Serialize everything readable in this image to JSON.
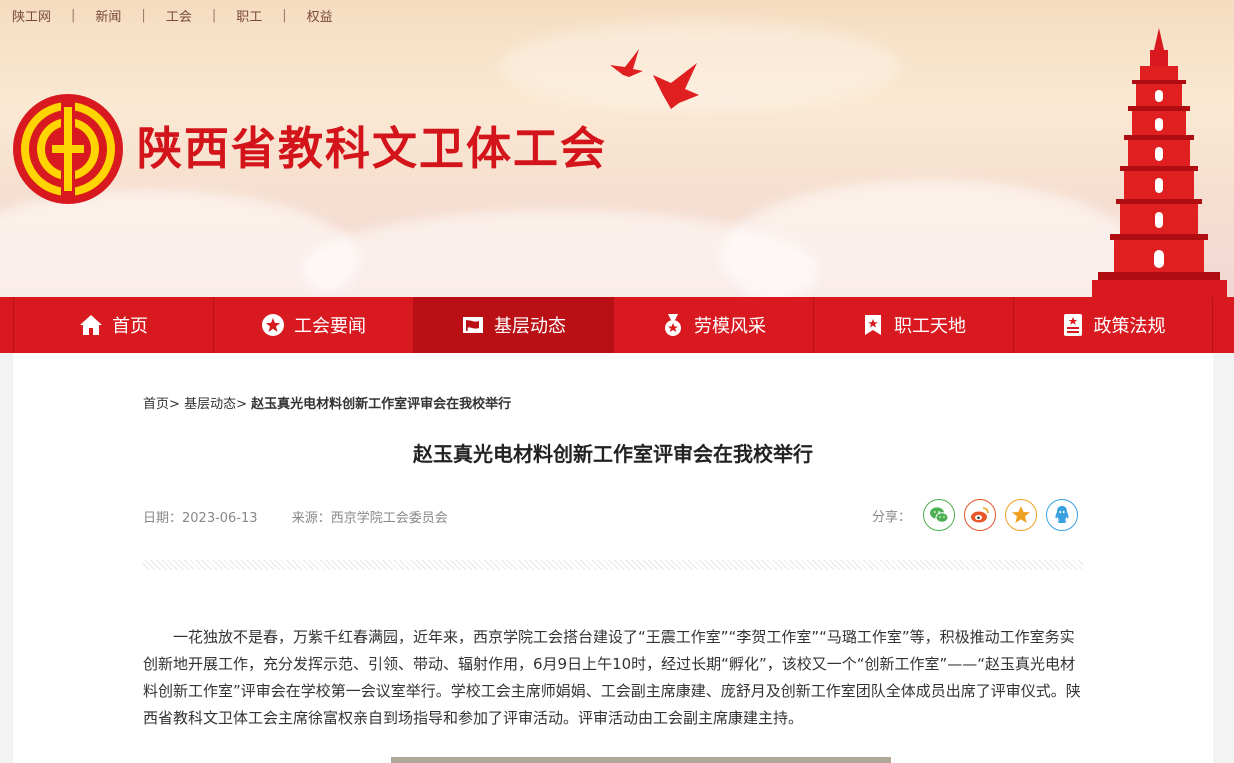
{
  "toplinks": [
    "陕工网",
    "新闻",
    "工会",
    "职工",
    "权益"
  ],
  "site_title": "陕西省教科文卫体工会",
  "nav": {
    "items": [
      {
        "label": "首页",
        "icon": "home-icon"
      },
      {
        "label": "工会要闻",
        "icon": "star-circle-icon"
      },
      {
        "label": "基层动态",
        "icon": "flag-icon"
      },
      {
        "label": "劳模风采",
        "icon": "medal-icon"
      },
      {
        "label": "职工天地",
        "icon": "bookmark-star-icon"
      },
      {
        "label": "政策法规",
        "icon": "document-star-icon"
      }
    ],
    "active_index": 2
  },
  "breadcrumb": {
    "home": "首页",
    "sep1": ">",
    "section": "基层动态",
    "sep2": ">",
    "current": "赵玉真光电材料创新工作室评审会在我校举行"
  },
  "article": {
    "title": "赵玉真光电材料创新工作室评审会在我校举行",
    "date": "日期：2023-06-13",
    "source": "来源：西京学院工会委员会",
    "body": "一花独放不是春，万紫千红春满园，近年来，西京学院工会搭台建设了“王震工作室”“李贺工作室”“马璐工作室”等，积极推动工作室务实创新地开展工作，充分发挥示范、引领、带动、辐射作用，6月9日上午10时，经过长期“孵化”，该校又一个“创新工作室”——“赵玉真光电材料创新工作室”评审会在学校第一会议室举行。学校工会主席师娟娟、工会副主席康建、庞舒月及创新工作室团队全体成员出席了评审仪式。陕西省教科文卫体工会主席徐富权亲自到场指导和参加了评审活动。评审活动由工会副主席康建主持。"
  },
  "share": {
    "label": "分享：",
    "buttons": [
      {
        "name": "wechat",
        "icon": "wechat-icon",
        "color": "#4caf50"
      },
      {
        "name": "weibo",
        "icon": "weibo-icon",
        "color": "#e8562a"
      },
      {
        "name": "qzone",
        "icon": "qzone-star-icon",
        "color": "#f0a020"
      },
      {
        "name": "qq",
        "icon": "qq-icon",
        "color": "#3aa0e0"
      }
    ]
  },
  "colors": {
    "brand_red": "#d8191f",
    "nav_active": "#ba0f15",
    "title_red": "#d3141b",
    "logo_yellow": "#ffd400"
  }
}
